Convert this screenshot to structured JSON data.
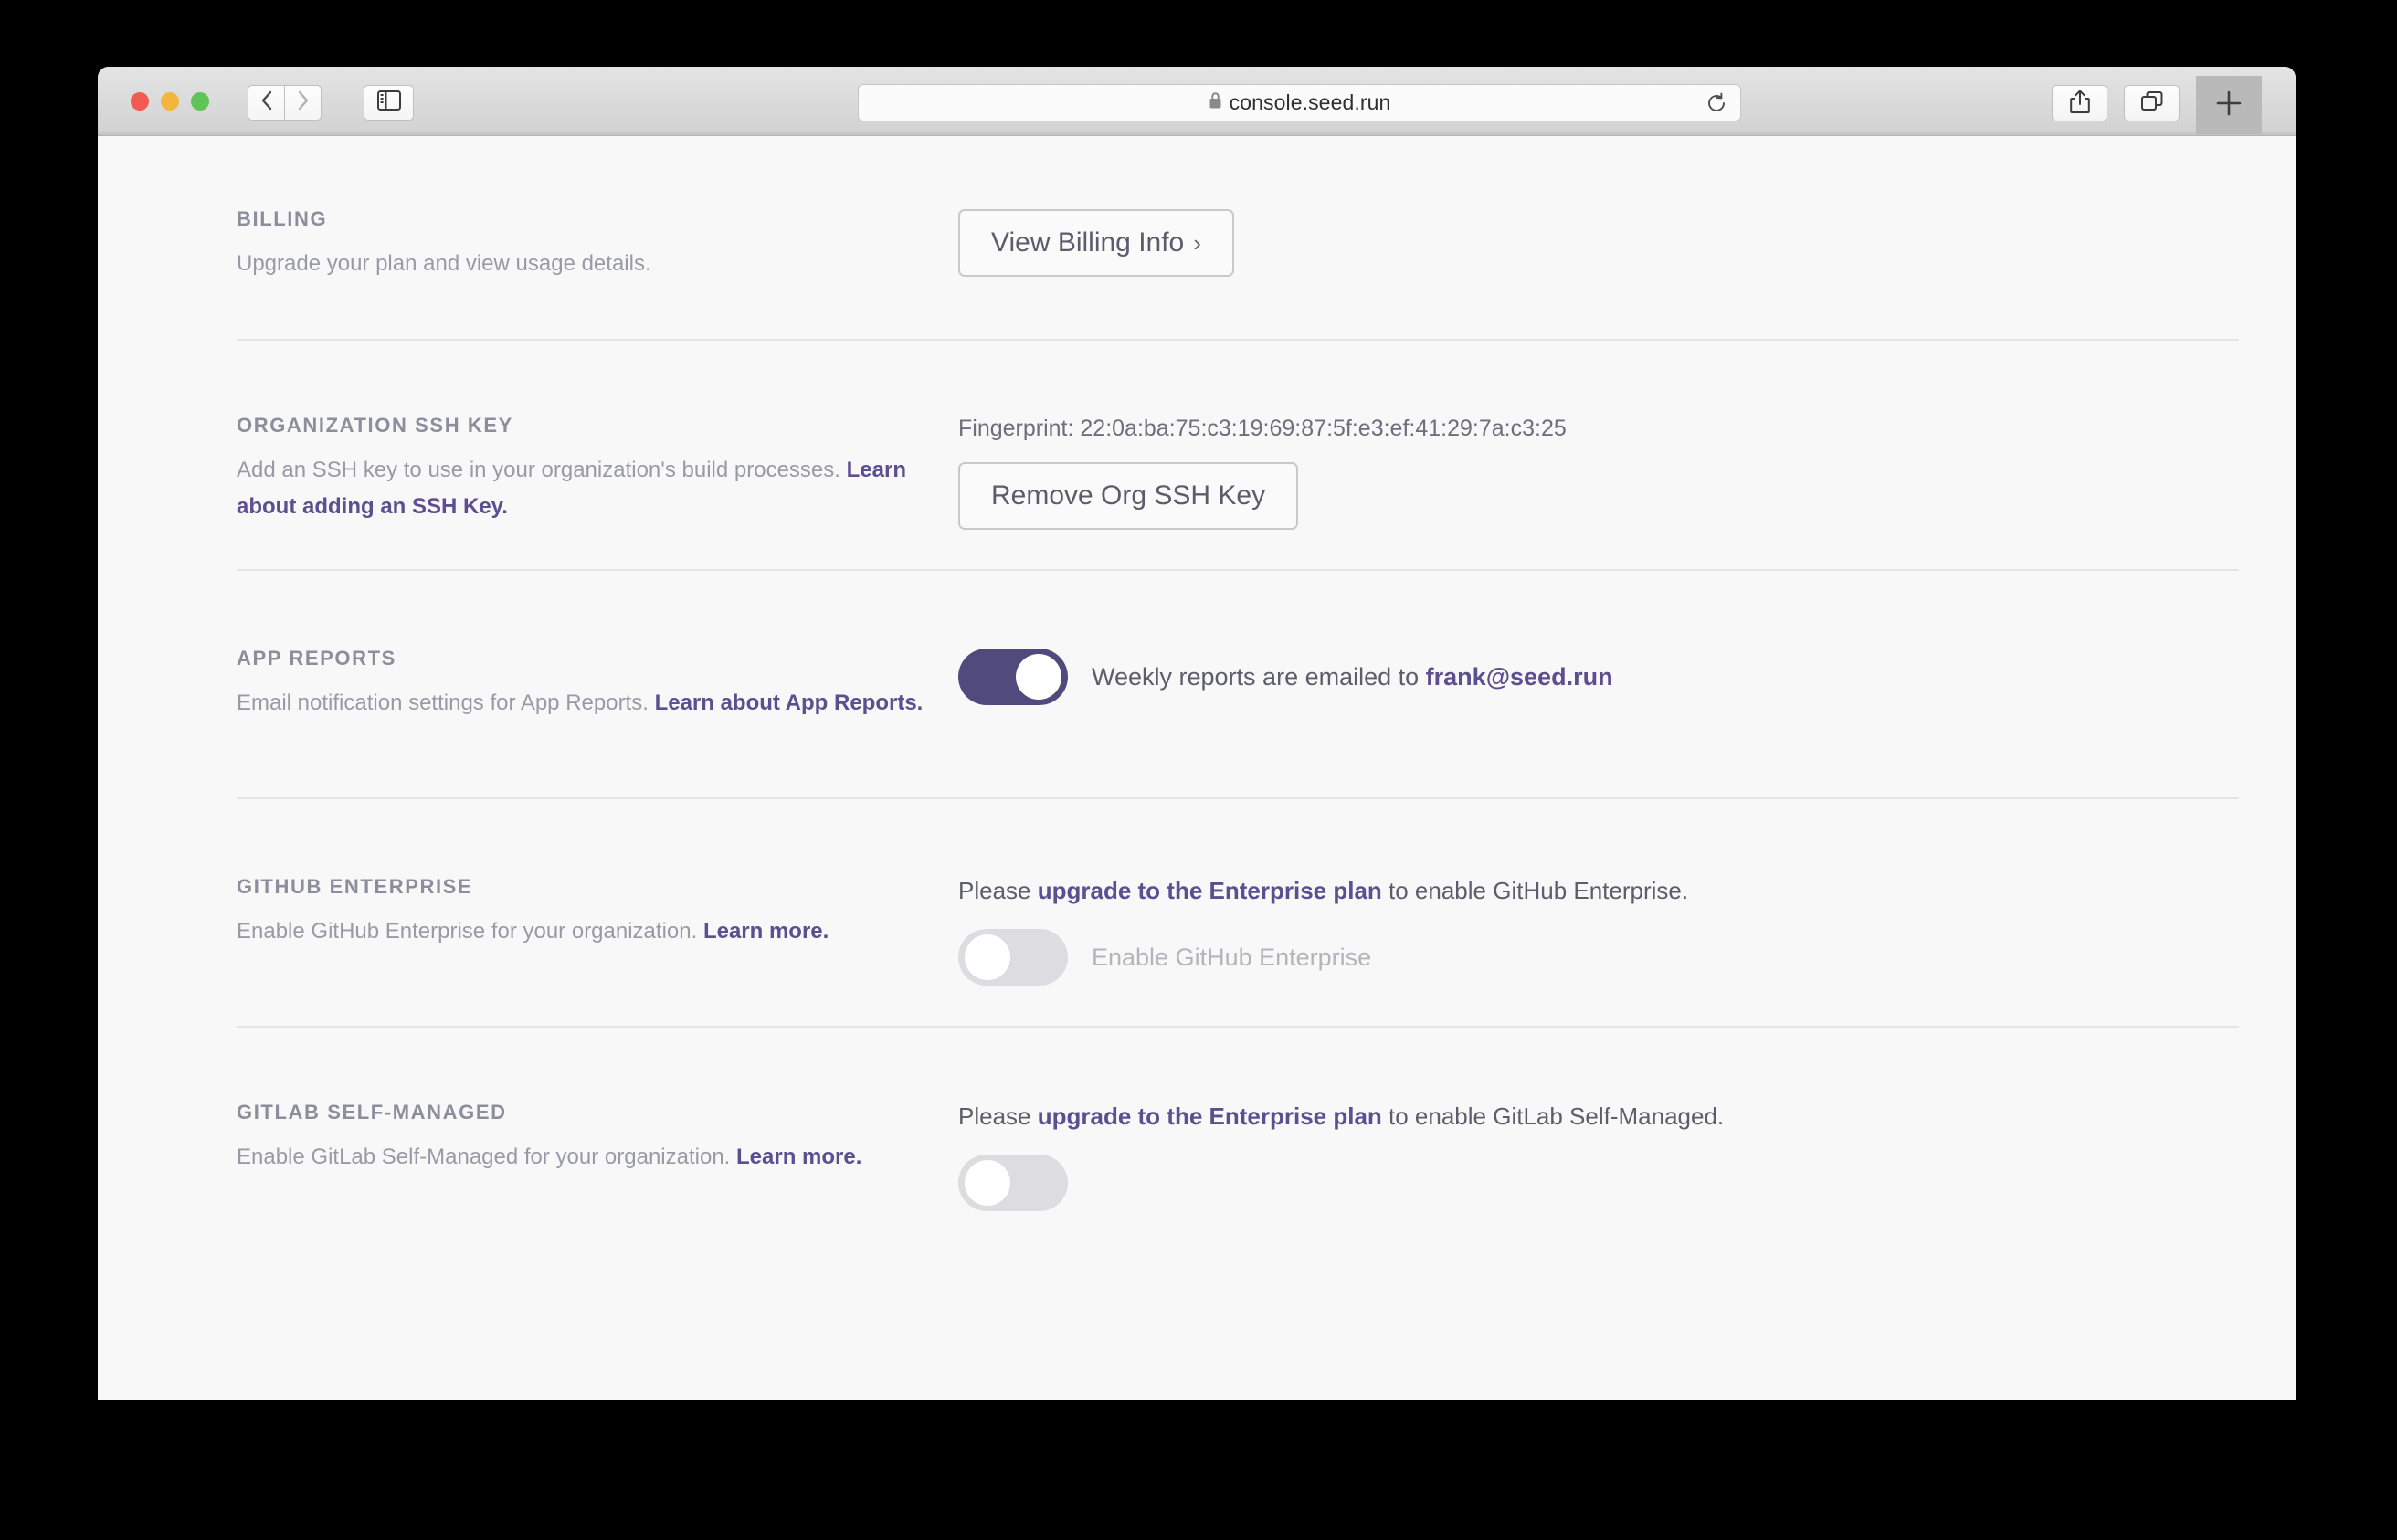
{
  "browser": {
    "url": "console.seed.run",
    "lock_icon": "lock-icon",
    "reload_icon": "reload-icon",
    "back_icon": "chevron-left-icon",
    "forward_icon": "chevron-right-icon",
    "sidebar_icon": "sidebar-toggle-icon",
    "share_icon": "share-icon",
    "tabs_icon": "tab-overview-icon",
    "newtab_icon": "plus-icon",
    "traffic_lights": [
      "close-button",
      "minimize-button",
      "zoom-button"
    ]
  },
  "sections": {
    "billing": {
      "title": "Billing",
      "description": "Upgrade your plan and view usage details.",
      "button_label": "View Billing Info",
      "button_chevron": "›"
    },
    "ssh": {
      "title": "Organization SSH Key",
      "description_before": "Add an SSH key to use in your organization's build processes. ",
      "link_text": "Learn about adding an SSH Key.",
      "fingerprint": "Fingerprint: 22:0a:ba:75:c3:19:69:87:5f:e3:ef:41:29:7a:c3:25",
      "button_label": "Remove Org SSH Key"
    },
    "reports": {
      "title": "App Reports",
      "description_before": "Email notification settings for App Reports. ",
      "link_text": "Learn about App Reports.",
      "toggle_state": "on",
      "toggle_text_before": "Weekly reports are emailed to ",
      "email": "frank@seed.run"
    },
    "github_enterprise": {
      "title": "GitHub Enterprise",
      "description_before": "Enable GitHub Enterprise for your organization. ",
      "link_text": "Learn more.",
      "notice_before": "Please ",
      "notice_link": "upgrade to the Enterprise plan",
      "notice_after": " to enable GitHub Enterprise.",
      "toggle_state": "off",
      "toggle_label": "Enable GitHub Enterprise"
    },
    "gitlab": {
      "title": "GitLab Self-Managed",
      "description_before": "Enable GitLab Self-Managed for your organization. ",
      "link_text": "Learn more.",
      "notice_before": "Please ",
      "notice_link": "upgrade to the Enterprise plan",
      "notice_after": " to enable GitLab Self-Managed.",
      "toggle_state": "off"
    }
  },
  "colors": {
    "accent": "#5c4f90",
    "toggle_on": "#514a7d",
    "toggle_off": "#dcdce1",
    "heading": "#8d8d9b",
    "page_bg": "#f8f8f9"
  }
}
